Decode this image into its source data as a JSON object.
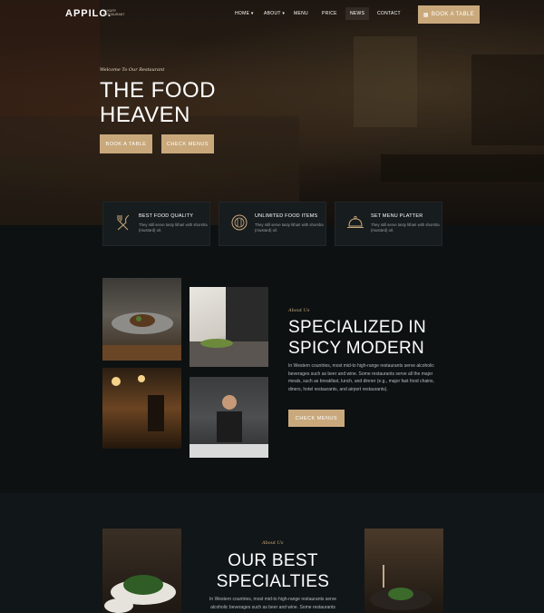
{
  "header": {
    "logo": "APPILO.",
    "logo_sub": "LUXURY RESTAURANT",
    "nav": [
      "HOME",
      "ABOUT",
      "MENU",
      "PRICE",
      "NEWS",
      "CONTACT"
    ],
    "active_nav": "NEWS",
    "book_button": "BOOK A TABLE"
  },
  "hero": {
    "welcome": "Welcome To Our Restaurant",
    "title_line1": "THE FOOD",
    "title_line2": "HEAVEN",
    "btn_book": "BOOK A TABLE",
    "btn_menus": "CHECK MENUS"
  },
  "features": [
    {
      "title": "BEST FOOD QUALITY",
      "desc": "They still serve tasty lithari with shorsha (mustard) oil.",
      "icon": "fork-knife-icon"
    },
    {
      "title": "UNLIMITED FOOD ITEMS",
      "desc": "They still serve tasty lithari with shorsha (mustard) oil.",
      "icon": "plate-icon"
    },
    {
      "title": "SET MENU PLATTER",
      "desc": "They still serve tasty lithari with shorsha (mustard) oil.",
      "icon": "cloche-icon"
    }
  ],
  "specialized": {
    "tag": "About Us",
    "title_line1": "SPECIALIZED IN",
    "title_line2": "SPICY MODERN",
    "text": "In Western countries, most mid-to high-range restaurants serve alcoholic beverages such as beer and wine. Some restaurants serve all the major meals, such as breakfast, lunch, and dinner (e.g., major fast food chains, diners, hotel restaurants, and airport restaurants).",
    "button": "CHECK MENUS"
  },
  "specialties": {
    "tag": "About Us",
    "title_line1": "OUR BEST",
    "title_line2": "SPECIALTIES",
    "text": "In Western countries, most mid-to high-range restaurants serve alcoholic beverages such as beer and wine. Some restaurants"
  },
  "colors": {
    "accent": "#c9a97c",
    "background": "#0d1112",
    "card": "#171c1e"
  }
}
